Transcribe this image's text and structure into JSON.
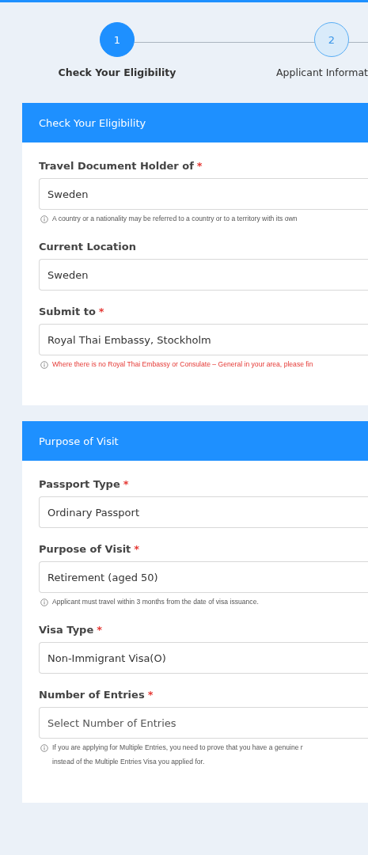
{
  "steps": [
    {
      "number": "1",
      "label": "Check Your Eligibility",
      "selected": true
    },
    {
      "number": "2",
      "label": "Applicant Informat",
      "selected": false
    }
  ],
  "sections": [
    {
      "title": "Check Your Eligibility",
      "fields": [
        {
          "label": "Travel Document Holder of",
          "required_mark": "*",
          "value": "Sweden",
          "hint": {
            "kind": "info",
            "text": "A country or a nationality may be referred to a country or to a territory with its own"
          }
        },
        {
          "label": "Current Location",
          "value": "Sweden"
        },
        {
          "label": "Submit to",
          "required_mark": "*",
          "value": "Royal Thai Embassy, Stockholm",
          "hint": {
            "kind": "warning",
            "text": "Where there is no Royal Thai Embassy or Consulate – General in your area, please fin"
          }
        }
      ]
    },
    {
      "title": "Purpose of Visit",
      "fields": [
        {
          "label": "Passport Type",
          "required_mark": "*",
          "value": "Ordinary Passport"
        },
        {
          "label": "Purpose of Visit",
          "required_mark": "*",
          "value": "Retirement (aged 50)",
          "hint": {
            "kind": "info",
            "text": "Applicant must travel within 3 months from the date of visa issuance."
          }
        },
        {
          "label": "Visa Type",
          "required_mark": "*",
          "value": "Non-Immigrant Visa(O)"
        },
        {
          "label": "Number of Entries",
          "required_mark": "*",
          "placeholder": "Select Number of Entries",
          "hint": {
            "kind": "info",
            "text": "If you are applying for Multiple Entries, you need to prove that you have a genuine r\ninstead of the Multiple Entries Visa you applied for."
          }
        }
      ]
    }
  ]
}
